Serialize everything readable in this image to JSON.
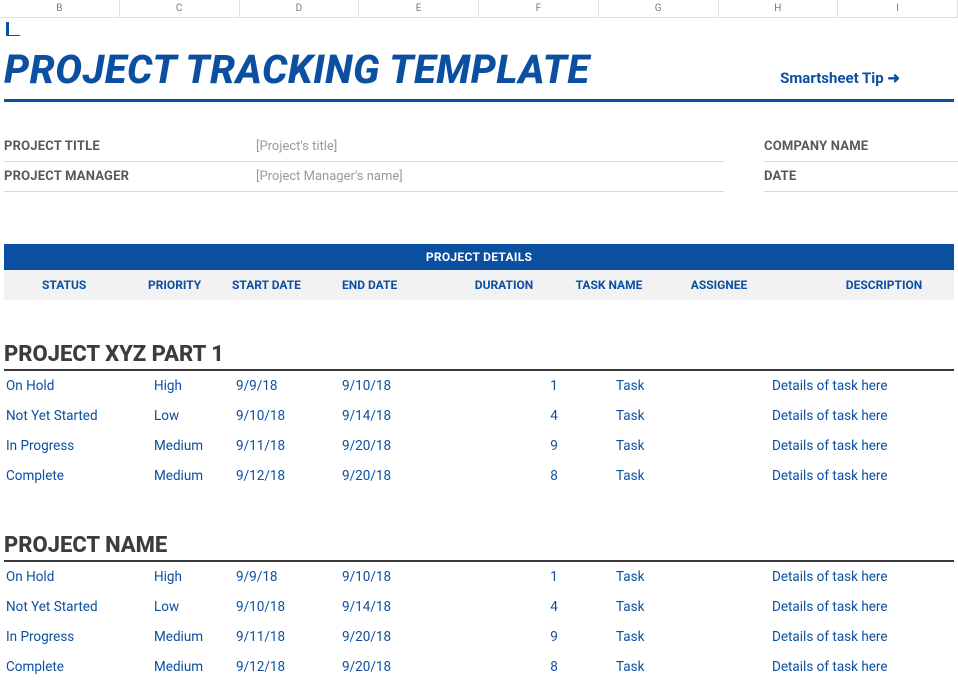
{
  "columns": [
    "B",
    "C",
    "D",
    "E",
    "F",
    "G",
    "H",
    "I"
  ],
  "title": "PROJECT TRACKING TEMPLATE",
  "tip": "Smartsheet Tip ➜",
  "meta": {
    "left": [
      {
        "label": "PROJECT TITLE",
        "value": "[Project's title]"
      },
      {
        "label": "PROJECT MANAGER",
        "value": "[Project Manager's name]"
      }
    ],
    "right": [
      {
        "label": "COMPANY NAME"
      },
      {
        "label": "DATE"
      }
    ]
  },
  "details_header": "PROJECT DETAILS",
  "table_headers": {
    "status": "STATUS",
    "priority": "PRIORITY",
    "start": "START DATE",
    "end": "END DATE",
    "duration": "DURATION",
    "task": "TASK NAME",
    "assignee": "ASSIGNEE",
    "description": "DESCRIPTION"
  },
  "sections": [
    {
      "name": "PROJECT XYZ PART 1",
      "rows": [
        {
          "status": "On Hold",
          "priority": "High",
          "start": "9/9/18",
          "end": "9/10/18",
          "duration": "1",
          "task": "Task",
          "assignee": "",
          "description": "Details of task here"
        },
        {
          "status": "Not Yet Started",
          "priority": "Low",
          "start": "9/10/18",
          "end": "9/14/18",
          "duration": "4",
          "task": "Task",
          "assignee": "",
          "description": "Details of task here"
        },
        {
          "status": "In Progress",
          "priority": "Medium",
          "start": "9/11/18",
          "end": "9/20/18",
          "duration": "9",
          "task": "Task",
          "assignee": "",
          "description": "Details of task here"
        },
        {
          "status": "Complete",
          "priority": "Medium",
          "start": "9/12/18",
          "end": "9/20/18",
          "duration": "8",
          "task": "Task",
          "assignee": "",
          "description": "Details of task here"
        }
      ]
    },
    {
      "name": "PROJECT NAME",
      "rows": [
        {
          "status": "On Hold",
          "priority": "High",
          "start": "9/9/18",
          "end": "9/10/18",
          "duration": "1",
          "task": "Task",
          "assignee": "",
          "description": "Details of task here"
        },
        {
          "status": "Not Yet Started",
          "priority": "Low",
          "start": "9/10/18",
          "end": "9/14/18",
          "duration": "4",
          "task": "Task",
          "assignee": "",
          "description": "Details of task here"
        },
        {
          "status": "In Progress",
          "priority": "Medium",
          "start": "9/11/18",
          "end": "9/20/18",
          "duration": "9",
          "task": "Task",
          "assignee": "",
          "description": "Details of task here"
        },
        {
          "status": "Complete",
          "priority": "Medium",
          "start": "9/12/18",
          "end": "9/20/18",
          "duration": "8",
          "task": "Task",
          "assignee": "",
          "description": "Details of task here"
        }
      ]
    }
  ]
}
